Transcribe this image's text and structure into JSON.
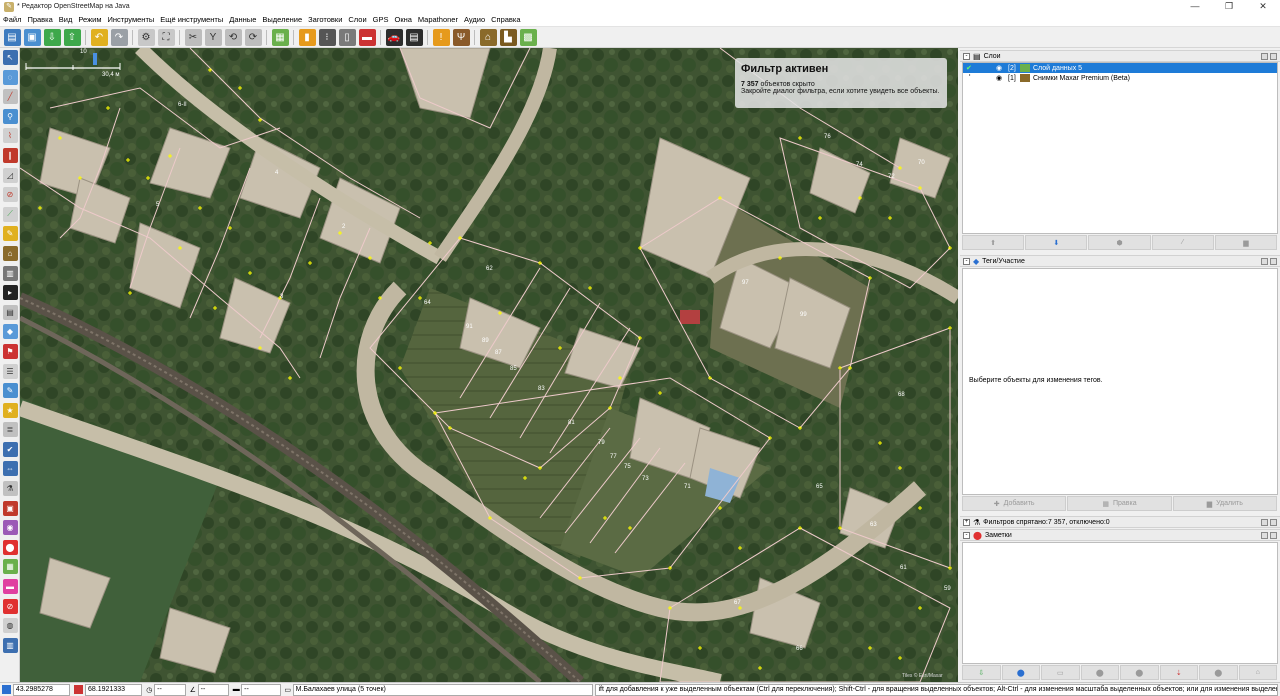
{
  "window": {
    "title": "* Редактор OpenStreetMap на Java"
  },
  "menu": [
    "Файл",
    "Правка",
    "Вид",
    "Режим",
    "Инструменты",
    "Ещё инструменты",
    "Данные",
    "Выделение",
    "Заготовки",
    "Слои",
    "GPS",
    "Окна",
    "Mapathoner",
    "Аудио",
    "Справка"
  ],
  "map": {
    "scale_top": "10",
    "scale_label": "30,4 м",
    "attribution": "Tiles © Esri/Maxar",
    "filter_popup": {
      "title": "Фильтр активен",
      "hidden_count": "7 357",
      "hidden_text": "объектов скрыто",
      "hint": "Закройте диалог фильтра, если хотите увидеть все объекты."
    },
    "house_numbers": [
      "6-II",
      "4",
      "5",
      "2",
      "3",
      "91",
      "89",
      "87",
      "85",
      "83",
      "81",
      "79",
      "77",
      "75",
      "73",
      "71",
      "97",
      "99",
      "76",
      "74",
      "72",
      "70",
      "68",
      "65",
      "63",
      "61",
      "59",
      "67",
      "62",
      "64",
      "66"
    ]
  },
  "panels": {
    "layers": {
      "title": "Слои",
      "items": [
        {
          "index": "[2]",
          "name": "Слой данных 5",
          "selected": true
        },
        {
          "index": "[1]",
          "name": "Снимки Maxar Premium (Beta)",
          "selected": false
        }
      ]
    },
    "tags": {
      "title": "Теги/Участие",
      "empty_text": "Выберите объекты для изменения тегов.",
      "add_label": "Добавить",
      "edit_label": "Правка",
      "delete_label": "Удалить"
    },
    "filter": {
      "title": "Фильтров спрятано:7 357, отключено:0"
    },
    "notes": {
      "title": "Заметки"
    }
  },
  "status": {
    "lat": "43.2985278",
    "lon": "68.1921333",
    "heading": "--",
    "angle": "--",
    "distance": "--",
    "selection": "М.Балахаев улица (5 точек)",
    "help": "ift для добавления к уже выделенным объектам (Ctrl для переключения); Shift-Ctrl - для вращения выделенных объектов; Alt-Ctrl - для изменения масштаба выделенных объектов; или для изменения выделения"
  },
  "colors": {
    "accent": "#1e7bd7",
    "boundary": "#e8c4c4",
    "node": "#ffff00",
    "popup_bg": "#e1e1e1"
  }
}
